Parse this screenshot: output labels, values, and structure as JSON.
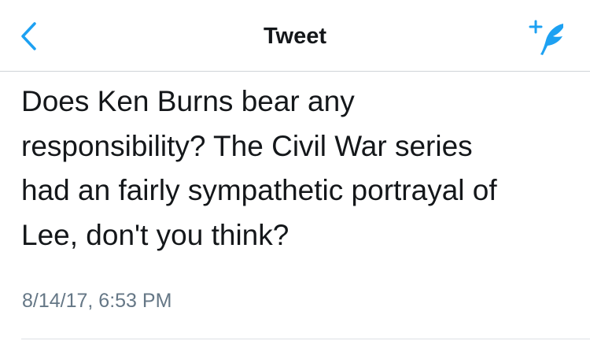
{
  "header": {
    "title": "Tweet",
    "back_icon": "chevron-left-icon",
    "compose_icon": "compose-feather-icon",
    "accent_color": "#1da1f2"
  },
  "tweet": {
    "text": "Does Ken Burns bear any\nresponsibility? The Civil War series\nhad an fairly sympathetic portrayal of\nLee, don't you think?",
    "timestamp": "8/14/17, 6:53 PM"
  }
}
